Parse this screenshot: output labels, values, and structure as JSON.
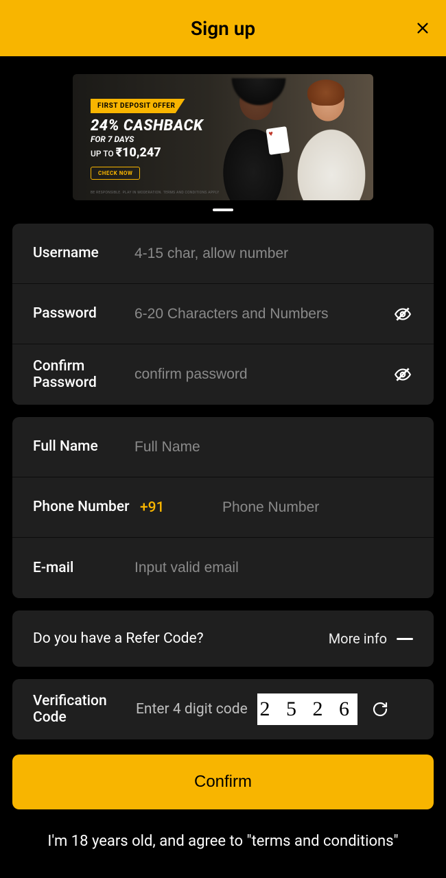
{
  "header": {
    "title": "Sign up"
  },
  "promo": {
    "tag": "FIRST DEPOSIT OFFER",
    "cashback": "24% CASHBACK",
    "days": "FOR 7 DAYS",
    "upto_prefix": "UP TO ",
    "upto_amount": "₹10,247",
    "button": "CHECK NOW",
    "fineprint": "BE RESPONSIBLE. PLAY IN MODERATION. TERMS AND CONDITIONS APPLY"
  },
  "fields": {
    "username": {
      "label": "Username",
      "placeholder": "4-15 char, allow number"
    },
    "password": {
      "label": "Password",
      "placeholder": "6-20 Characters and Numbers"
    },
    "confirm_password": {
      "label": "Confirm Password",
      "placeholder": "confirm password"
    },
    "fullname": {
      "label": "Full Name",
      "placeholder": "Full Name"
    },
    "phone": {
      "label": "Phone Number",
      "dial_code": "+91",
      "placeholder": "Phone Number"
    },
    "email": {
      "label": "E-mail",
      "placeholder": "Input valid email"
    }
  },
  "refer": {
    "question": "Do you have a Refer Code?",
    "more": "More info"
  },
  "verification": {
    "label": "Verification Code",
    "hint": "Enter 4 digit code",
    "captcha": "2 5 2 6"
  },
  "confirm": "Confirm",
  "agreement": "I'm 18 years old, and agree to \"terms and conditions\""
}
